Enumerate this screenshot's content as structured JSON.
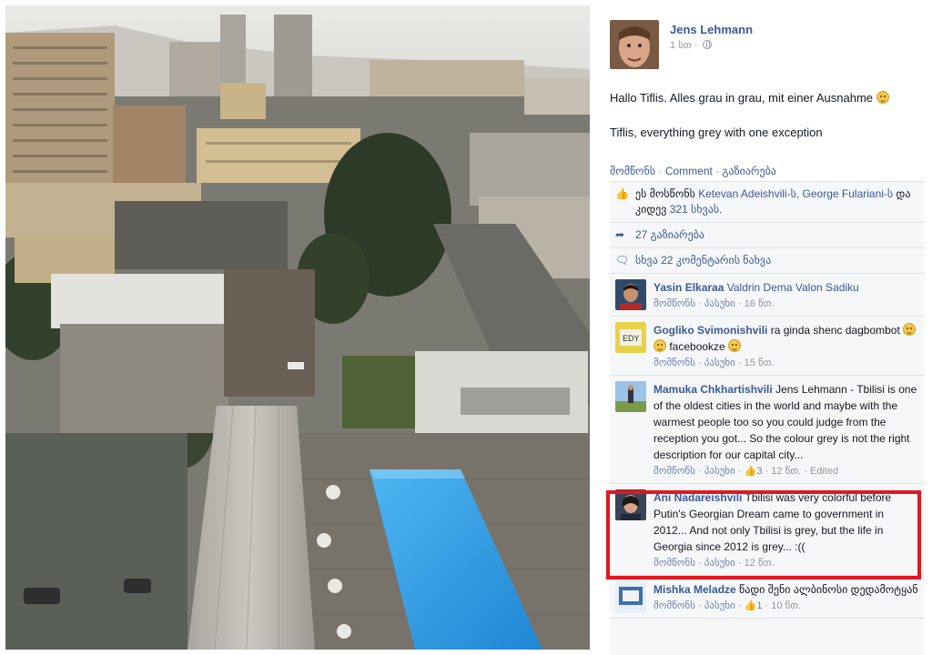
{
  "post": {
    "author": "Jens Lehmann",
    "time": "1 სთ ·",
    "text_de": "Hallo Tiflis. Alles grau in grau, mit einer Ausnahme",
    "text_en": "Tiflis, everything grey with one exception",
    "actions": {
      "like": "მომწონს",
      "comment": "Comment",
      "share": "გაზიარება"
    }
  },
  "ufi": {
    "likes_prefix": "ეს მოსწონს",
    "liker1": "Ketevan Adeishvili-ს,",
    "liker2": "George Fulariani-ს",
    "likes_mid": "და კიდევ",
    "likes_count": "321",
    "likes_suffix": "სხვას.",
    "shares": "27 გაზიარება",
    "view_more": "სხვა 22 კომენტარის ნახვა"
  },
  "comments": [
    {
      "name": "Yasin Elkaraa",
      "text": "",
      "tags": "Valdrin Dema Valon Sadiku",
      "like": "მომწონს",
      "reply": "პასუხი",
      "reactions": "",
      "time": "16 წთ.",
      "edited": ""
    },
    {
      "name": "Gogliko Svimonishvili",
      "text": "ra ginda shenc dagbombot",
      "text2": "facebookze",
      "tags": "",
      "like": "მომწონს",
      "reply": "პასუხი",
      "reactions": "",
      "time": "15 წთ.",
      "edited": ""
    },
    {
      "name": "Mamuka Chkhartishvili",
      "text": "Jens Lehmann - Tbilisi is one of the oldest cities in the world and maybe with the warmest people too so you could judge from the reception you got... So the colour grey is not the right description for our capital city...",
      "tags": "",
      "like": "მომწონს",
      "reply": "პასუხი",
      "reactions": "3",
      "time": "12 წთ.",
      "edited": "Edited"
    },
    {
      "name": "Ani Nadareishvili",
      "text": "Tbilisi was very colorful before Putin's Georgian Dream came to government in 2012... And not only Tbilisi is grey, but the life in Georgia since 2012 is grey... :((",
      "tags": "",
      "like": "მომწონს",
      "reply": "პასუხი",
      "reactions": "",
      "time": "12 წთ.",
      "edited": ""
    },
    {
      "name": "Mishka Meladze",
      "text": "წადი შენი ალბინოსი დედამოტყან",
      "tags": "",
      "like": "მომწონს",
      "reply": "პასუხი",
      "reactions": "1",
      "time": "10 წთ.",
      "edited": ""
    }
  ],
  "colors": {
    "link": "#3b5998",
    "muted": "#9197a3",
    "highlight": "#e3161f",
    "pool": "#3aa3e8"
  }
}
